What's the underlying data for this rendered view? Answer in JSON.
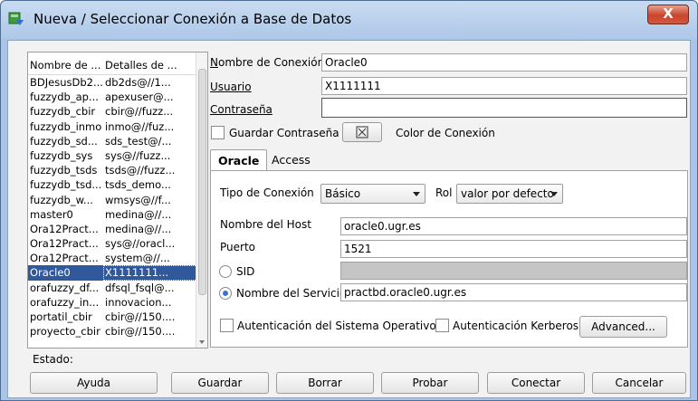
{
  "window": {
    "title": "Nueva / Seleccionar Conexión a Base de Datos",
    "close_label": "X"
  },
  "connections": {
    "headers": [
      "Nombre de ...",
      "Detalles de ..."
    ],
    "rows": [
      [
        "BDJesusDb2...",
        "db2ds@//1..."
      ],
      [
        "fuzzydb_ap...",
        "apexuser@..."
      ],
      [
        "fuzzydb_cbir",
        "cbir@//fuzz..."
      ],
      [
        "fuzzydb_inmo",
        "inmo@//fuz..."
      ],
      [
        "fuzzydb_sd...",
        "sds_test@/..."
      ],
      [
        "fuzzydb_sys",
        "sys@//fuzz..."
      ],
      [
        "fuzzydb_tsds",
        "tsds@//fuzz..."
      ],
      [
        "fuzzydb_tsd...",
        "tsds_demo..."
      ],
      [
        "fuzzydb_w...",
        "wmsys@//f..."
      ],
      [
        "master0",
        "medina@//..."
      ],
      [
        "Ora12Pract...",
        "medina@//..."
      ],
      [
        "Ora12Pract...",
        "sys@//oracl..."
      ],
      [
        "Ora12Pract...",
        "system@//..."
      ],
      [
        "Oracle0",
        "X1111111..."
      ],
      [
        "orafuzzy_df...",
        "dfsql_fsql@..."
      ],
      [
        "orafuzzy_in...",
        "innovacion..."
      ],
      [
        "portatil_cbir",
        "cbir@//150...."
      ],
      [
        "proyecto_cbir",
        "cbir@//150...."
      ]
    ],
    "selected_index": 13
  },
  "status": {
    "label": "Estado:"
  },
  "form": {
    "connection_name_label": "Nombre de Conexión",
    "connection_name_value": "Oracle0",
    "user_label": "Usuario",
    "user_value": "X1111111",
    "password_label": "Contraseña",
    "password_value": "",
    "save_password_label": "Guardar Contraseña",
    "color_label": "Color de Conexión",
    "color_icon": "color-picker-icon"
  },
  "tabs": [
    {
      "label": "Oracle",
      "active": true
    },
    {
      "label": "Access",
      "active": false
    }
  ],
  "oracle": {
    "conn_type_label": "Tipo de Conexión",
    "conn_type_value": "Básico",
    "role_label": "Rol",
    "role_value": "valor por defecto",
    "host_label": "Nombre del Host",
    "host_value": "oracle0.ugr.es",
    "port_label": "Puerto",
    "port_value": "1521",
    "sid_label": "SID",
    "sid_value": "",
    "service_label": "Nombre del Servicio",
    "service_value": "practbd.oracle0.ugr.es",
    "os_auth_label": "Autenticación del Sistema Operativo",
    "kerberos_label": "Autenticación Kerberos",
    "advanced_label": "Advanced..."
  },
  "buttons": {
    "help": "Ayuda",
    "save": "Guardar",
    "delete": "Borrar",
    "test": "Probar",
    "connect": "Conectar",
    "cancel": "Cancelar"
  },
  "colors": {
    "title_gradient_top": "#c9dbf1",
    "selection": "#30599c",
    "close_button": "#c8452d"
  }
}
